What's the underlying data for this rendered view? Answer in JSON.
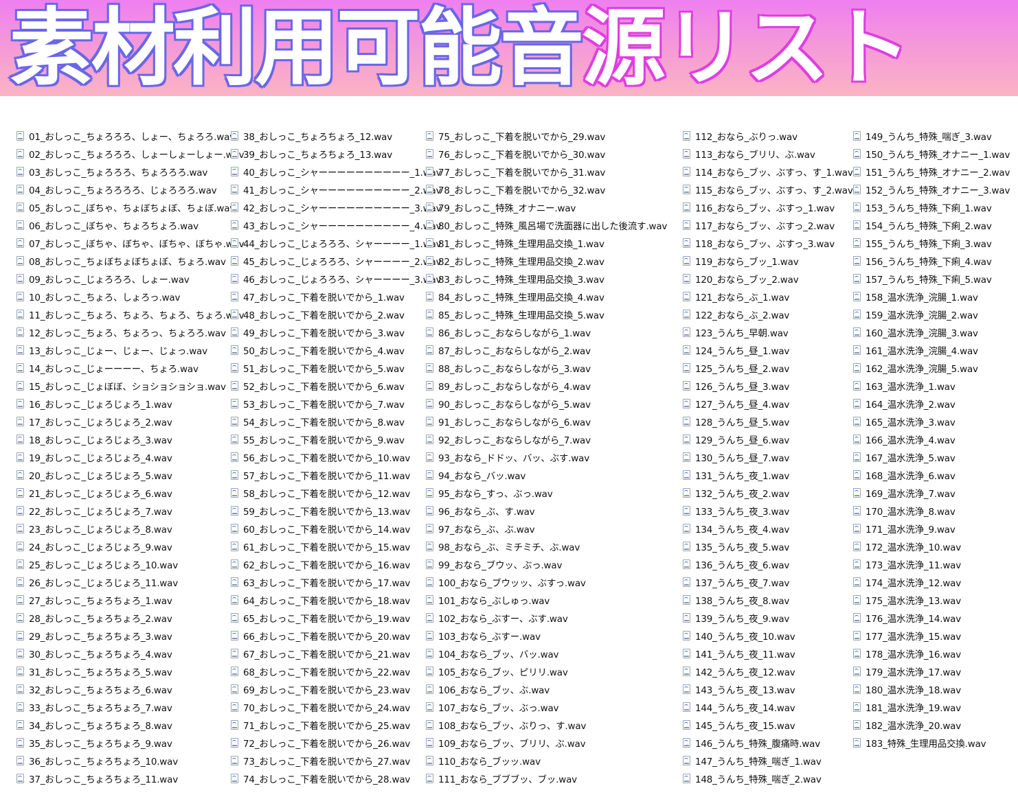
{
  "banner": {
    "title_main": "素材利用可能音",
    "title_accent": "源リスト"
  },
  "colors": {
    "banner_gradient_top": "#ee7ff0",
    "banner_gradient_bottom": "#fbb3c4",
    "title_outline_blue": "#6a67e8",
    "title_outline_magenta": "#df3fe0"
  },
  "icon": "wav-file-icon",
  "columns": [
    [
      "01_おしっこ_ちょろろろ、しょー、ちょろろ.wav",
      "02_おしっこ_ちょろろろ、しょーしょーしょー.wav",
      "03_おしっこ_ちょろろろ、ちょろろろ.wav",
      "04_おしっこ_ちょろろろろ、じょろろろ.wav",
      "05_おしっこ_ぼちゃ、ちょぼちょぼ、ちょぼ.wav",
      "06_おしっこ_ぼちゃ、ちょろちょろ.wav",
      "07_おしっこ_ぼちゃ、ぼちゃ、ぼちゃ、ぼちゃ.wav",
      "08_おしっこ_ちょぼちょぼちょぼ、ちょろ.wav",
      "09_おしっこ_じょろろろ、しょー.wav",
      "10_おしっこ_ちょろ、しょろっ.wav",
      "11_おしっこ_ちょろ、ちょろ、ちょろ、ちょろ.wav",
      "12_おしっこ_ちょろ、ちょろっ、ちょろろ.wav",
      "13_おしっこ_じょー、じょー、じょっ.wav",
      "14_おしっこ_じょーーーー、ちょろ.wav",
      "15_おしっこ_じょぼぼ、ショショショショ.wav",
      "16_おしっこ_じょろじょろ_1.wav",
      "17_おしっこ_じょろじょろ_2.wav",
      "18_おしっこ_じょろじょろ_3.wav",
      "19_おしっこ_じょろじょろ_4.wav",
      "20_おしっこ_じょろじょろ_5.wav",
      "21_おしっこ_じょろじょろ_6.wav",
      "22_おしっこ_じょろじょろ_7.wav",
      "23_おしっこ_じょろじょろ_8.wav",
      "24_おしっこ_じょろじょろ_9.wav",
      "25_おしっこ_じょろじょろ_10.wav",
      "26_おしっこ_じょろじょろ_11.wav",
      "27_おしっこ_ちょろちょろ_1.wav",
      "28_おしっこ_ちょろちょろ_2.wav",
      "29_おしっこ_ちょろちょろ_3.wav",
      "30_おしっこ_ちょろちょろ_4.wav",
      "31_おしっこ_ちょろちょろ_5.wav",
      "32_おしっこ_ちょろちょろ_6.wav",
      "33_おしっこ_ちょろちょろ_7.wav",
      "34_おしっこ_ちょろちょろ_8.wav",
      "35_おしっこ_ちょろちょろ_9.wav",
      "36_おしっこ_ちょろちょろ_10.wav",
      "37_おしっこ_ちょろちょろ_11.wav"
    ],
    [
      "38_おしっこ_ちょろちょろ_12.wav",
      "39_おしっこ_ちょろちょろ_13.wav",
      "40_おしっこ_シャーーーーーーーーーー_1.wav",
      "41_おしっこ_シャーーーーーーーーーー_2.wav",
      "42_おしっこ_シャーーーーーーーーーー_3.wav",
      "43_おしっこ_シャーーーーーーーーーー_4.wav",
      "44_おしっこ_じょろろろ、シャーーーー_1.wav",
      "45_おしっこ_じょろろろ、シャーーーー_2.wav",
      "46_おしっこ_じょろろろ、シャーーーー_3.wav",
      "47_おしっこ_下着を脱いでから_1.wav",
      "48_おしっこ_下着を脱いでから_2.wav",
      "49_おしっこ_下着を脱いでから_3.wav",
      "50_おしっこ_下着を脱いでから_4.wav",
      "51_おしっこ_下着を脱いでから_5.wav",
      "52_おしっこ_下着を脱いでから_6.wav",
      "53_おしっこ_下着を脱いでから_7.wav",
      "54_おしっこ_下着を脱いでから_8.wav",
      "55_おしっこ_下着を脱いでから_9.wav",
      "56_おしっこ_下着を脱いでから_10.wav",
      "57_おしっこ_下着を脱いでから_11.wav",
      "58_おしっこ_下着を脱いでから_12.wav",
      "59_おしっこ_下着を脱いでから_13.wav",
      "60_おしっこ_下着を脱いでから_14.wav",
      "61_おしっこ_下着を脱いでから_15.wav",
      "62_おしっこ_下着を脱いでから_16.wav",
      "63_おしっこ_下着を脱いでから_17.wav",
      "64_おしっこ_下着を脱いでから_18.wav",
      "65_おしっこ_下着を脱いでから_19.wav",
      "66_おしっこ_下着を脱いでから_20.wav",
      "67_おしっこ_下着を脱いでから_21.wav",
      "68_おしっこ_下着を脱いでから_22.wav",
      "69_おしっこ_下着を脱いでから_23.wav",
      "70_おしっこ_下着を脱いでから_24.wav",
      "71_おしっこ_下着を脱いでから_25.wav",
      "72_おしっこ_下着を脱いでから_26.wav",
      "73_おしっこ_下着を脱いでから_27.wav",
      "74_おしっこ_下着を脱いでから_28.wav"
    ],
    [
      "75_おしっこ_下着を脱いでから_29.wav",
      "76_おしっこ_下着を脱いでから_30.wav",
      "77_おしっこ_下着を脱いでから_31.wav",
      "78_おしっこ_下着を脱いでから_32.wav",
      "79_おしっこ_特殊_オナニー.wav",
      "80_おしっこ_特殊_風呂場で洗面器に出した後流す.wav",
      "81_おしっこ_特殊_生理用品交換_1.wav",
      "82_おしっこ_特殊_生理用品交換_2.wav",
      "83_おしっこ_特殊_生理用品交換_3.wav",
      "84_おしっこ_特殊_生理用品交換_4.wav",
      "85_おしっこ_特殊_生理用品交換_5.wav",
      "86_おしっこ_おならしながら_1.wav",
      "87_おしっこ_おならしながら_2.wav",
      "88_おしっこ_おならしながら_3.wav",
      "89_おしっこ_おならしながら_4.wav",
      "90_おしっこ_おならしながら_5.wav",
      "91_おしっこ_おならしながら_6.wav",
      "92_おしっこ_おならしながら_7.wav",
      "93_おなら_ドドッ、バッ、ぶす.wav",
      "94_おなら_バッ.wav",
      "95_おなら_すっ、ぶっ.wav",
      "96_おなら_ぶ、す.wav",
      "97_おなら_ぶ、ぶ.wav",
      "98_おなら_ぶ、ミチミチ、ぶ.wav",
      "99_おなら_ブウッ、ぶっ.wav",
      "100_おなら_ブウッッ、ぶすっ.wav",
      "101_おなら_ぶしゅっ.wav",
      "102_おなら_ぶすー、ぶす.wav",
      "103_おなら_ぶすー.wav",
      "104_おなら_ブッ、バッ.wav",
      "105_おなら_ブッ、ピリリ.wav",
      "106_おなら_ブッ、ぶ.wav",
      "107_おなら_ブッ、ぶっ.wav",
      "108_おなら_ブッ、ぶりっ、す.wav",
      "109_おなら_ブッ、ブリリ、ぶ.wav",
      "110_おなら_ブッッ.wav",
      "111_おなら_ブブブッ、ブッ.wav"
    ],
    [
      "112_おなら_ぶりっ.wav",
      "113_おなら_ブリリ、ぶ.wav",
      "114_おなら_ブッ、ぶすっ、す_1.wav",
      "115_おなら_ブッ、ぶすっ、す_2.wav",
      "116_おなら_ブッ、ぶすっ_1.wav",
      "117_おなら_ブッ、ぶすっ_2.wav",
      "118_おなら_ブッ、ぶすっ_3.wav",
      "119_おなら_ブッ_1.wav",
      "120_おなら_ブッ_2.wav",
      "121_おなら_ぶ_1.wav",
      "122_おなら_ぶ_2.wav",
      "123_うんち_早朝.wav",
      "124_うんち_昼_1.wav",
      "125_うんち_昼_2.wav",
      "126_うんち_昼_3.wav",
      "127_うんち_昼_4.wav",
      "128_うんち_昼_5.wav",
      "129_うんち_昼_6.wav",
      "130_うんち_昼_7.wav",
      "131_うんち_夜_1.wav",
      "132_うんち_夜_2.wav",
      "133_うんち_夜_3.wav",
      "134_うんち_夜_4.wav",
      "135_うんち_夜_5.wav",
      "136_うんち_夜_6.wav",
      "137_うんち_夜_7.wav",
      "138_うんち_夜_8.wav",
      "139_うんち_夜_9.wav",
      "140_うんち_夜_10.wav",
      "141_うんち_夜_11.wav",
      "142_うんち_夜_12.wav",
      "143_うんち_夜_13.wav",
      "144_うんち_夜_14.wav",
      "145_うんち_夜_15.wav",
      "146_うんち_特殊_腹痛時.wav",
      "147_うんち_特殊_喘ぎ_1.wav",
      "148_うんち_特殊_喘ぎ_2.wav"
    ],
    [
      "149_うんち_特殊_喘ぎ_3.wav",
      "150_うんち_特殊_オナニー_1.wav",
      "151_うんち_特殊_オナニー_2.wav",
      "152_うんち_特殊_オナニー_3.wav",
      "153_うんち_特殊_下痢_1.wav",
      "154_うんち_特殊_下痢_2.wav",
      "155_うんち_特殊_下痢_3.wav",
      "156_うんち_特殊_下痢_4.wav",
      "157_うんち_特殊_下痢_5.wav",
      "158_温水洗浄_浣腸_1.wav",
      "159_温水洗浄_浣腸_2.wav",
      "160_温水洗浄_浣腸_3.wav",
      "161_温水洗浄_浣腸_4.wav",
      "162_温水洗浄_浣腸_5.wav",
      "163_温水洗浄_1.wav",
      "164_温水洗浄_2.wav",
      "165_温水洗浄_3.wav",
      "166_温水洗浄_4.wav",
      "167_温水洗浄_5.wav",
      "168_温水洗浄_6.wav",
      "169_温水洗浄_7.wav",
      "170_温水洗浄_8.wav",
      "171_温水洗浄_9.wav",
      "172_温水洗浄_10.wav",
      "173_温水洗浄_11.wav",
      "174_温水洗浄_12.wav",
      "175_温水洗浄_13.wav",
      "176_温水洗浄_14.wav",
      "177_温水洗浄_15.wav",
      "178_温水洗浄_16.wav",
      "179_温水洗浄_17.wav",
      "180_温水洗浄_18.wav",
      "181_温水洗浄_19.wav",
      "182_温水洗浄_20.wav",
      "183_特殊_生理用品交換.wav"
    ]
  ]
}
